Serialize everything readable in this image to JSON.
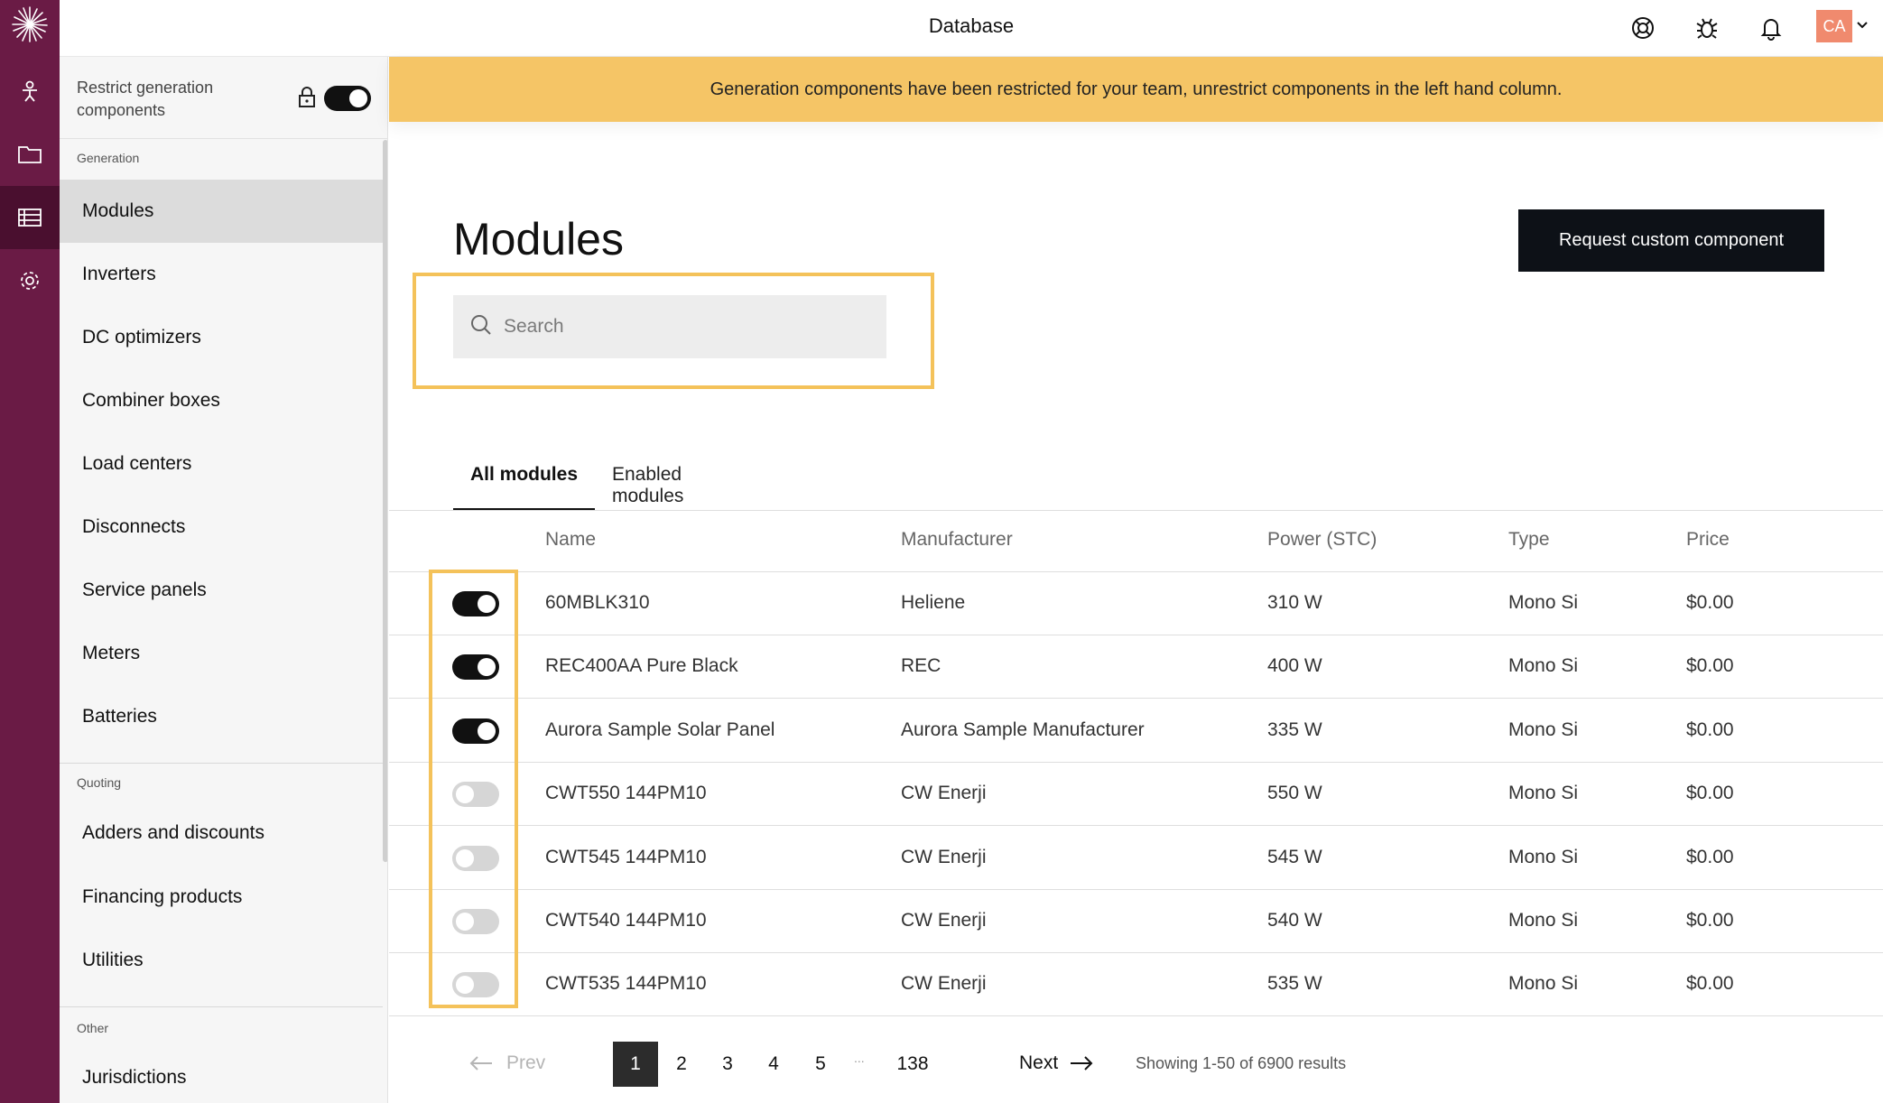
{
  "topbar": {
    "title": "Database",
    "avatar_initials": "CA",
    "icons": [
      "help-lifebuoy-icon",
      "bug-icon",
      "bell-icon"
    ]
  },
  "rail": {
    "items": [
      "sun-logo-icon",
      "person-icon",
      "folder-icon",
      "database-list-icon",
      "gear-icon"
    ],
    "active": "database-list-icon",
    "color": "#6a1b45"
  },
  "sidebar": {
    "restrict_label": "Restrict generation components",
    "restrict_enabled": true,
    "sections": [
      {
        "label": "Generation",
        "items": [
          "Modules",
          "Inverters",
          "DC optimizers",
          "Combiner boxes",
          "Load centers",
          "Disconnects",
          "Service panels",
          "Meters",
          "Batteries"
        ]
      },
      {
        "label": "Quoting",
        "items": [
          "Adders and discounts",
          "Financing products",
          "Utilities"
        ]
      },
      {
        "label": "Other",
        "items": [
          "Jurisdictions"
        ]
      }
    ],
    "active_item": "Modules"
  },
  "banner": {
    "text": "Generation components have been restricted for your team, unrestrict components in the left hand column.",
    "color": "#f5c566"
  },
  "main": {
    "title": "Modules",
    "request_button": "Request custom component",
    "search_placeholder": "Search",
    "tabs": [
      "All modules",
      "Enabled modules"
    ],
    "active_tab": "All modules"
  },
  "table": {
    "columns": [
      "Name",
      "Manufacturer",
      "Power (STC)",
      "Type",
      "Price"
    ],
    "rows": [
      {
        "enabled": true,
        "name": "60MBLK310",
        "manufacturer": "Heliene",
        "power": "310 W",
        "type": "Mono Si",
        "price": "$0.00"
      },
      {
        "enabled": true,
        "name": "REC400AA Pure Black",
        "manufacturer": "REC",
        "power": "400 W",
        "type": "Mono Si",
        "price": "$0.00"
      },
      {
        "enabled": true,
        "name": "Aurora Sample Solar Panel",
        "manufacturer": "Aurora Sample Manufacturer",
        "power": "335 W",
        "type": "Mono Si",
        "price": "$0.00"
      },
      {
        "enabled": false,
        "name": "CWT550 144PM10",
        "manufacturer": "CW Enerji",
        "power": "550 W",
        "type": "Mono Si",
        "price": "$0.00"
      },
      {
        "enabled": false,
        "name": "CWT545 144PM10",
        "manufacturer": "CW Enerji",
        "power": "545 W",
        "type": "Mono Si",
        "price": "$0.00"
      },
      {
        "enabled": false,
        "name": "CWT540 144PM10",
        "manufacturer": "CW Enerji",
        "power": "540 W",
        "type": "Mono Si",
        "price": "$0.00"
      },
      {
        "enabled": false,
        "name": "CWT535 144PM10",
        "manufacturer": "CW Enerji",
        "power": "535 W",
        "type": "Mono Si",
        "price": "$0.00"
      }
    ]
  },
  "pagination": {
    "prev": "Prev",
    "next": "Next",
    "pages": [
      "1",
      "2",
      "3",
      "4",
      "5"
    ],
    "ellipsis": "...",
    "last_page": "138",
    "current_page": "1",
    "showing": "Showing 1-50 of 6900 results"
  },
  "highlight_color": "#f4c25a"
}
